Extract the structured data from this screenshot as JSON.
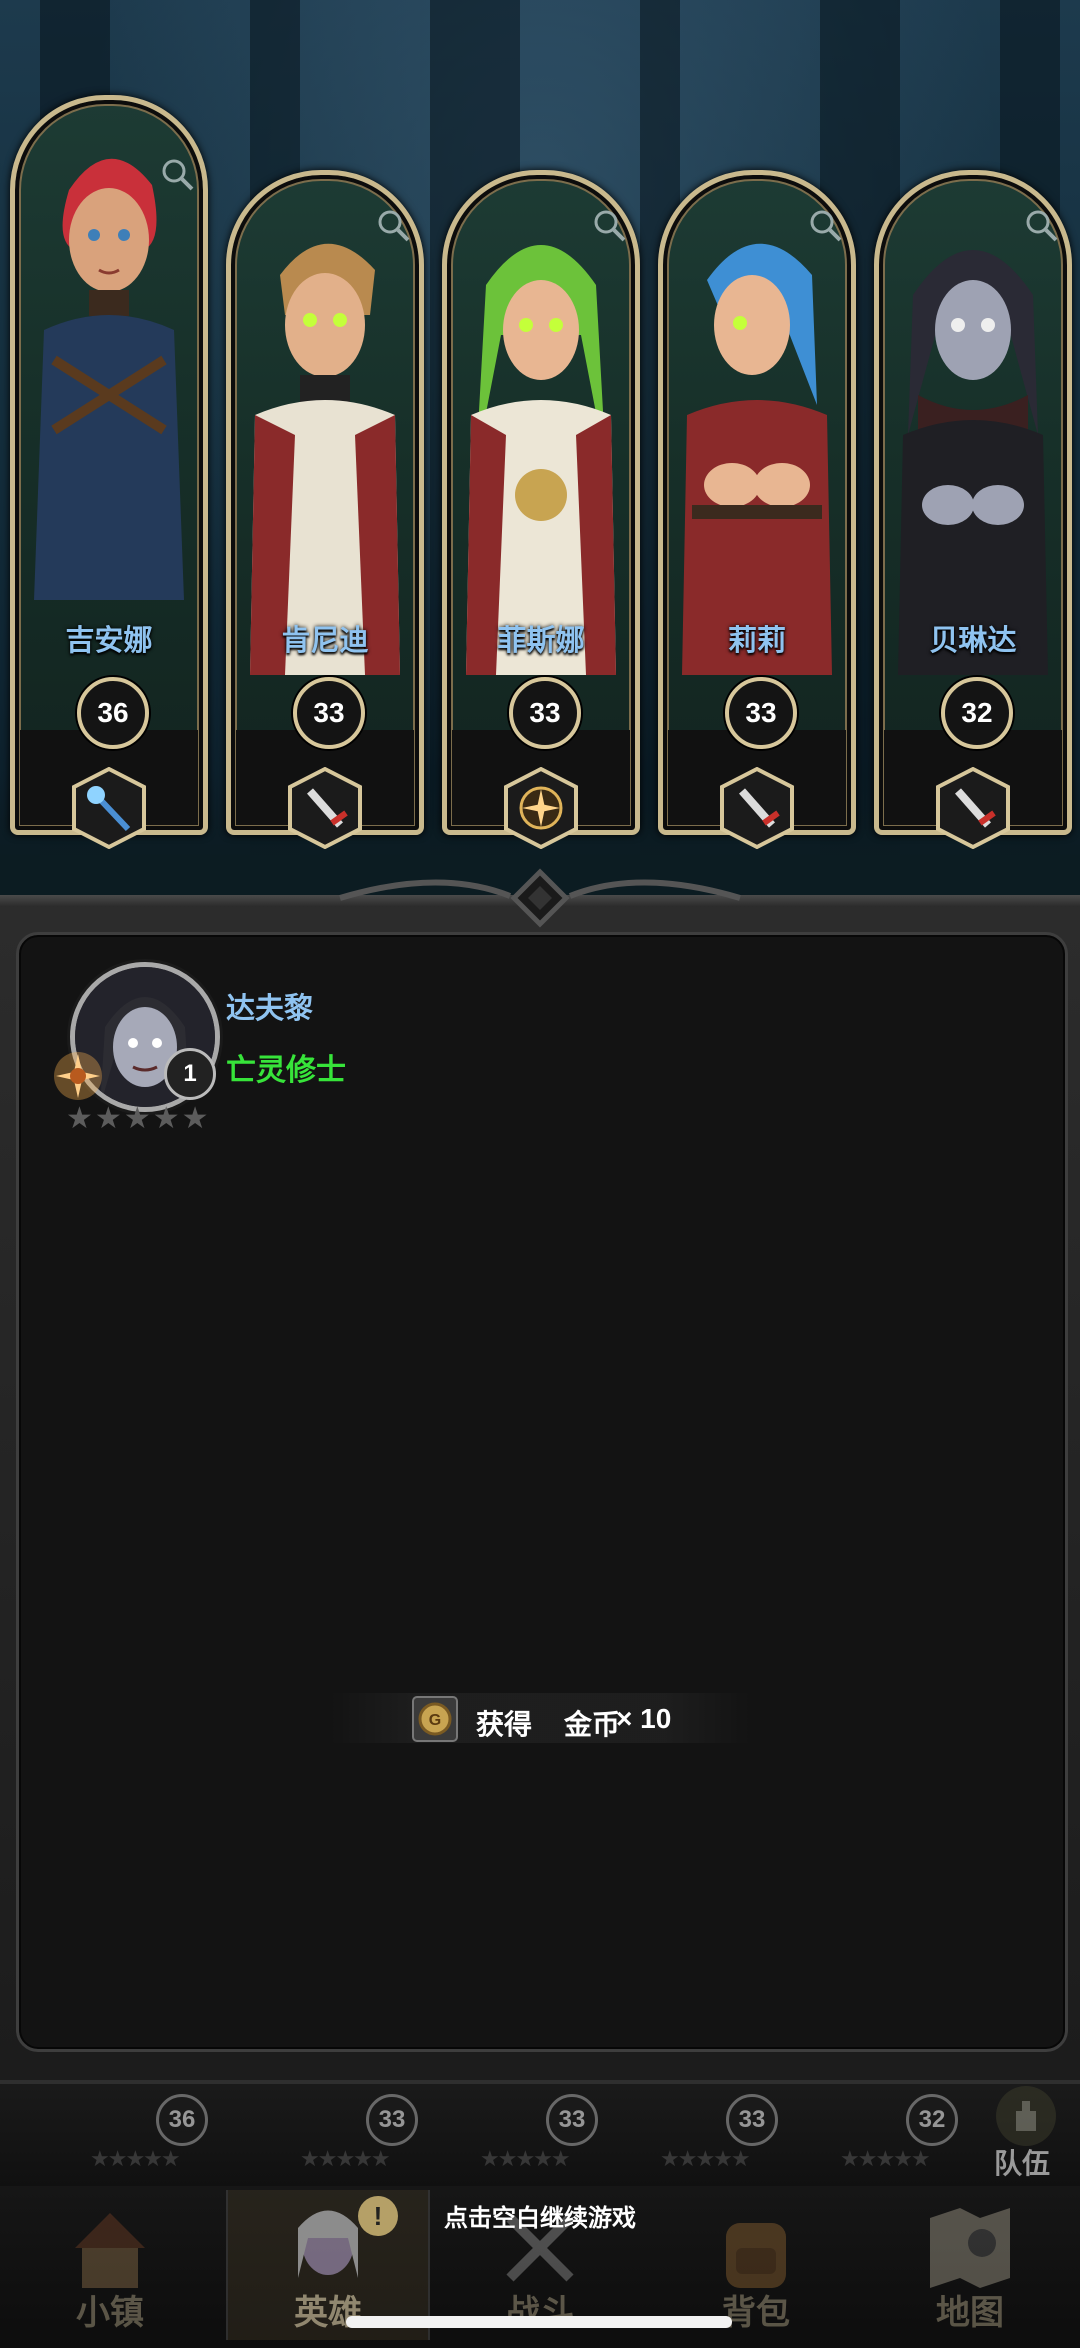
{
  "heroes": [
    {
      "name": "吉安娜",
      "level": "36",
      "weapon": "staff-icon",
      "hair": "#c9303a"
    },
    {
      "name": "肯尼迪",
      "level": "33",
      "weapon": "sword-icon",
      "hair": "#b98a4f"
    },
    {
      "name": "菲斯娜",
      "level": "33",
      "weapon": "holy-emblem-icon",
      "hair": "#6cc23a"
    },
    {
      "name": "莉莉",
      "level": "33",
      "weapon": "sword-icon",
      "hair": "#3e8fd4"
    },
    {
      "name": "贝琳达",
      "level": "32",
      "weapon": "sword-icon",
      "hair": "#2a2a35"
    }
  ],
  "selected_hero": {
    "name": "达夫黎",
    "class": "亡灵修士",
    "level": "1",
    "stars_filled": 0,
    "stars_total": 5
  },
  "toast": {
    "label": "获得",
    "item": "金币",
    "count": "× 10",
    "icon": "coin-icon"
  },
  "strip": {
    "levels": [
      "36",
      "33",
      "33",
      "33",
      "32"
    ],
    "team_label": "队伍"
  },
  "nav": {
    "items": [
      {
        "label": "小镇",
        "icon": "town-icon"
      },
      {
        "label": "英雄",
        "icon": "hero-icon",
        "active": true
      },
      {
        "label": "战斗",
        "icon": "battle-icon"
      },
      {
        "label": "背包",
        "icon": "backpack-icon"
      },
      {
        "label": "地图",
        "icon": "map-icon"
      }
    ],
    "continue_hint": "点击空白继续游戏"
  },
  "colors": {
    "name_blue": "#8fc3f0",
    "class_green": "#37e43a",
    "gold_frame": "#c9b98d"
  }
}
